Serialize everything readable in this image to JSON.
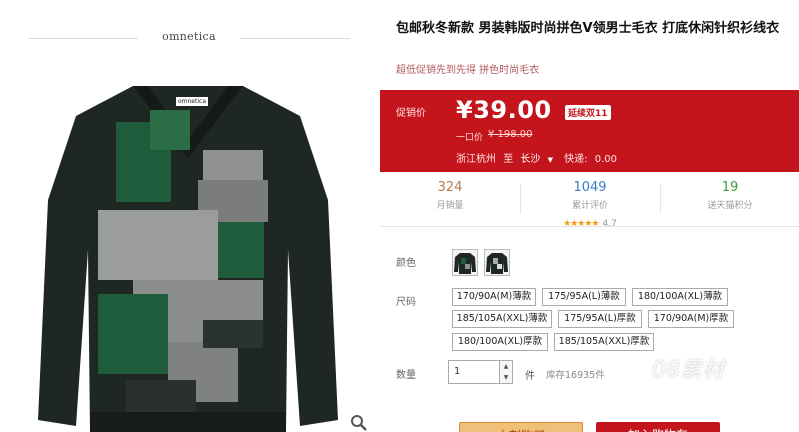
{
  "brand": {
    "name": "omnetica"
  },
  "product": {
    "title": "包邮秋冬新款 男装韩版时尚拼色V领男士毛衣 打底休闲针织衫线衣",
    "subtitle": "超低促销先到先得 拼色时尚毛衣",
    "collar_tag": "omnetica"
  },
  "price": {
    "label": "促销价",
    "value": "¥39.00",
    "badge": "延续双11",
    "original_label": "一口价",
    "original_value": "¥ 198.00"
  },
  "shipping": {
    "from": "浙江杭州",
    "to_label": "至",
    "to": "长沙",
    "fee_label": "快递:",
    "fee": "0.00"
  },
  "stats": {
    "sales": {
      "value": "324",
      "label": "月销量"
    },
    "reviews": {
      "value": "1049",
      "label": "累计评价",
      "stars": "★★★★★",
      "rating": "4.7"
    },
    "points": {
      "value": "19",
      "label": "送天猫积分"
    }
  },
  "options": {
    "color_label": "颜色",
    "size_label": "尺码",
    "sizes": [
      "170/90A(M)薄款",
      "175/95A(L)薄款",
      "180/100A(XL)薄款",
      "185/105A(XXL)薄款",
      "175/95A(L)厚款",
      "170/90A(M)厚款",
      "180/100A(XL)厚款",
      "185/105A(XXL)厚款"
    ],
    "qty_label": "数量",
    "qty_value": "1",
    "qty_unit": "件",
    "stock": "库存16935件"
  },
  "actions": {
    "buy": "立刻购买",
    "cart": "加入购物车"
  },
  "watermark": "08素材",
  "colors": {
    "accent_red": "#c4151d",
    "buy_orange": "#f0bf7a",
    "sweater_dark": "#1f2a22",
    "sweater_green": "#1f5c3c",
    "sweater_grey": "#8e9190"
  },
  "icons": {
    "zoom": "magnifier-icon",
    "up": "chevron-up-icon",
    "down": "chevron-down-icon"
  }
}
